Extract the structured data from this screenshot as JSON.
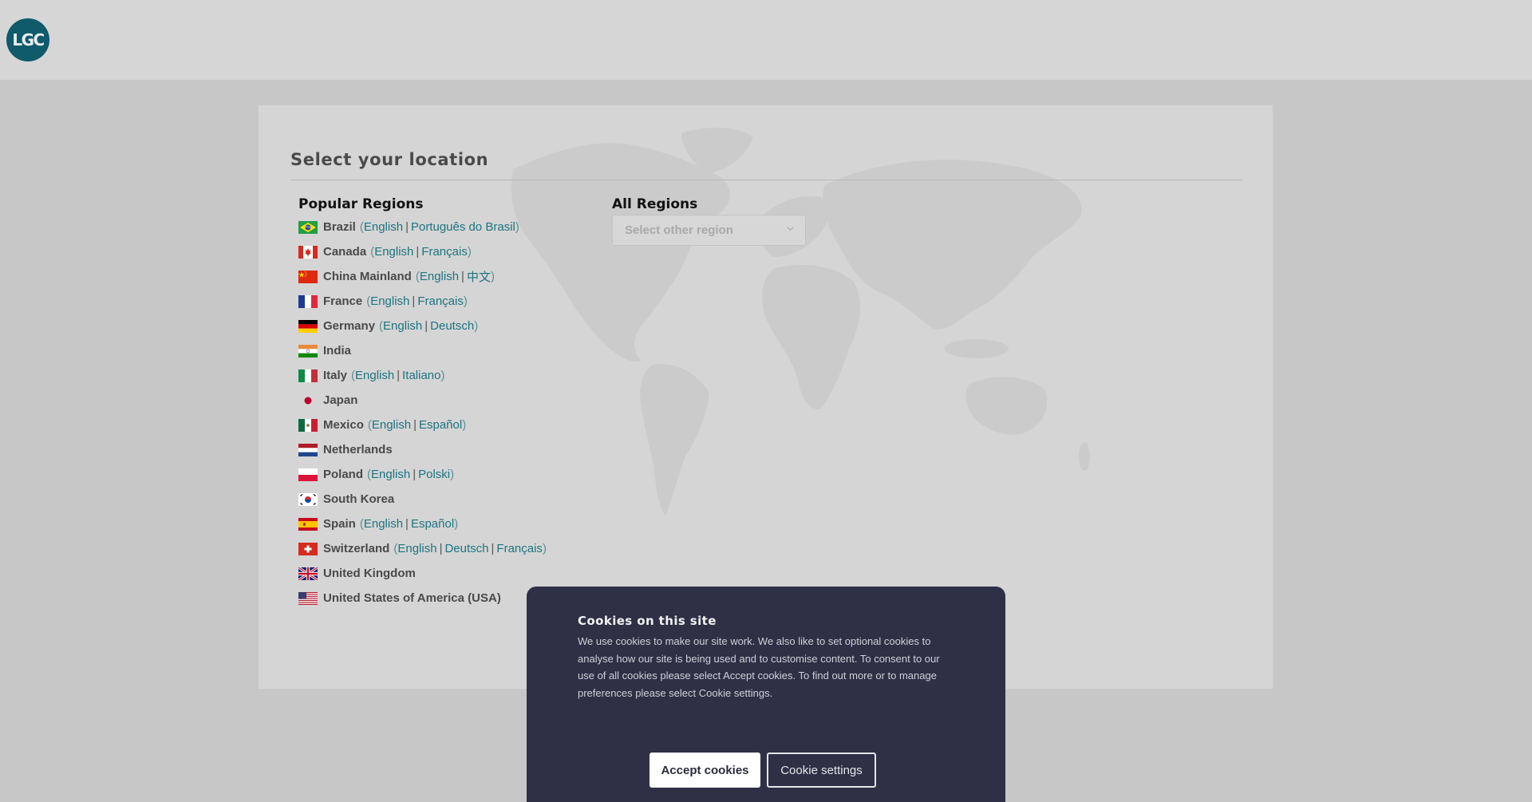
{
  "header": {
    "logo_text": "LGC"
  },
  "page": {
    "title": "Select your location",
    "popular_regions_title": "Popular Regions",
    "all_regions_title": "All Regions",
    "region_select": {
      "placeholder": "Select other region"
    }
  },
  "regions": [
    {
      "country": "Brazil",
      "flag": "flag-brazil",
      "languages": [
        "English",
        "Português do Brasil"
      ]
    },
    {
      "country": "Canada",
      "flag": "flag-canada",
      "languages": [
        "English",
        "Français"
      ]
    },
    {
      "country": "China Mainland",
      "flag": "flag-china",
      "languages": [
        "English",
        "中文"
      ]
    },
    {
      "country": "France",
      "flag": "flag-france",
      "languages": [
        "English",
        "Français"
      ]
    },
    {
      "country": "Germany",
      "flag": "flag-germany",
      "languages": [
        "English",
        "Deutsch"
      ]
    },
    {
      "country": "India",
      "flag": "flag-india",
      "languages": []
    },
    {
      "country": "Italy",
      "flag": "flag-italy",
      "languages": [
        "English",
        "Italiano"
      ]
    },
    {
      "country": "Japan",
      "flag": "flag-japan",
      "languages": []
    },
    {
      "country": "Mexico",
      "flag": "flag-mexico",
      "languages": [
        "English",
        "Español"
      ]
    },
    {
      "country": "Netherlands",
      "flag": "flag-netherlands",
      "languages": []
    },
    {
      "country": "Poland",
      "flag": "flag-poland",
      "languages": [
        "English",
        "Polski"
      ]
    },
    {
      "country": "South Korea",
      "flag": "flag-south-korea",
      "languages": []
    },
    {
      "country": "Spain",
      "flag": "flag-spain",
      "languages": [
        "English",
        "Español"
      ]
    },
    {
      "country": "Switzerland",
      "flag": "flag-switzerland",
      "languages": [
        "English",
        "Deutsch",
        "Français"
      ]
    },
    {
      "country": "United Kingdom",
      "flag": "flag-uk",
      "languages": []
    },
    {
      "country": "United States of America (USA)",
      "flag": "flag-usa",
      "languages": []
    }
  ],
  "cookie_banner": {
    "title": "Cookies on this site",
    "text": "We use cookies to make our site work. We also like to set optional cookies to analyse how our site is being used and to customise content. To consent to our use of all cookies please select Accept cookies. To find out more or to manage preferences please select Cookie settings.",
    "accept_label": "Accept cookies",
    "settings_label": "Cookie settings"
  },
  "colors": {
    "brand": "#0f5a6b",
    "link": "#1d7480",
    "cookie_bg": "#2f3046"
  }
}
